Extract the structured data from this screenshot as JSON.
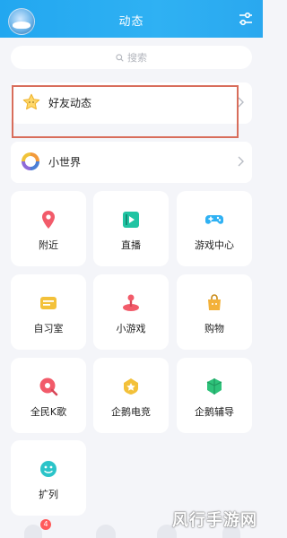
{
  "header": {
    "title": "动态"
  },
  "search": {
    "placeholder": "搜索"
  },
  "list": [
    {
      "label": "好友动态"
    },
    {
      "label": "小世界"
    }
  ],
  "tiles": [
    {
      "label": "附近",
      "icon": "location-pin-icon",
      "color": "#f25b6a"
    },
    {
      "label": "直播",
      "icon": "live-play-icon",
      "color": "#21c4a3"
    },
    {
      "label": "游戏中心",
      "icon": "gamepad-icon",
      "color": "#2fb1f3"
    },
    {
      "label": "自习室",
      "icon": "study-room-icon",
      "color": "#f3c13a"
    },
    {
      "label": "小游戏",
      "icon": "mini-game-icon",
      "color": "#f25b6a"
    },
    {
      "label": "购物",
      "icon": "shopping-bag-icon",
      "color": "#f3b13a"
    },
    {
      "label": "全民K歌",
      "icon": "karaoke-icon",
      "color": "#f25b6a"
    },
    {
      "label": "企鹅电竞",
      "icon": "esports-icon",
      "color": "#f3c13a"
    },
    {
      "label": "企鹅辅导",
      "icon": "tutoring-icon",
      "color": "#2ec27a"
    },
    {
      "label": "扩列",
      "icon": "make-friends-icon",
      "color": "#2bc4c9"
    }
  ],
  "bottom_bar": {
    "badge": "4"
  },
  "watermark": "风行手游网"
}
